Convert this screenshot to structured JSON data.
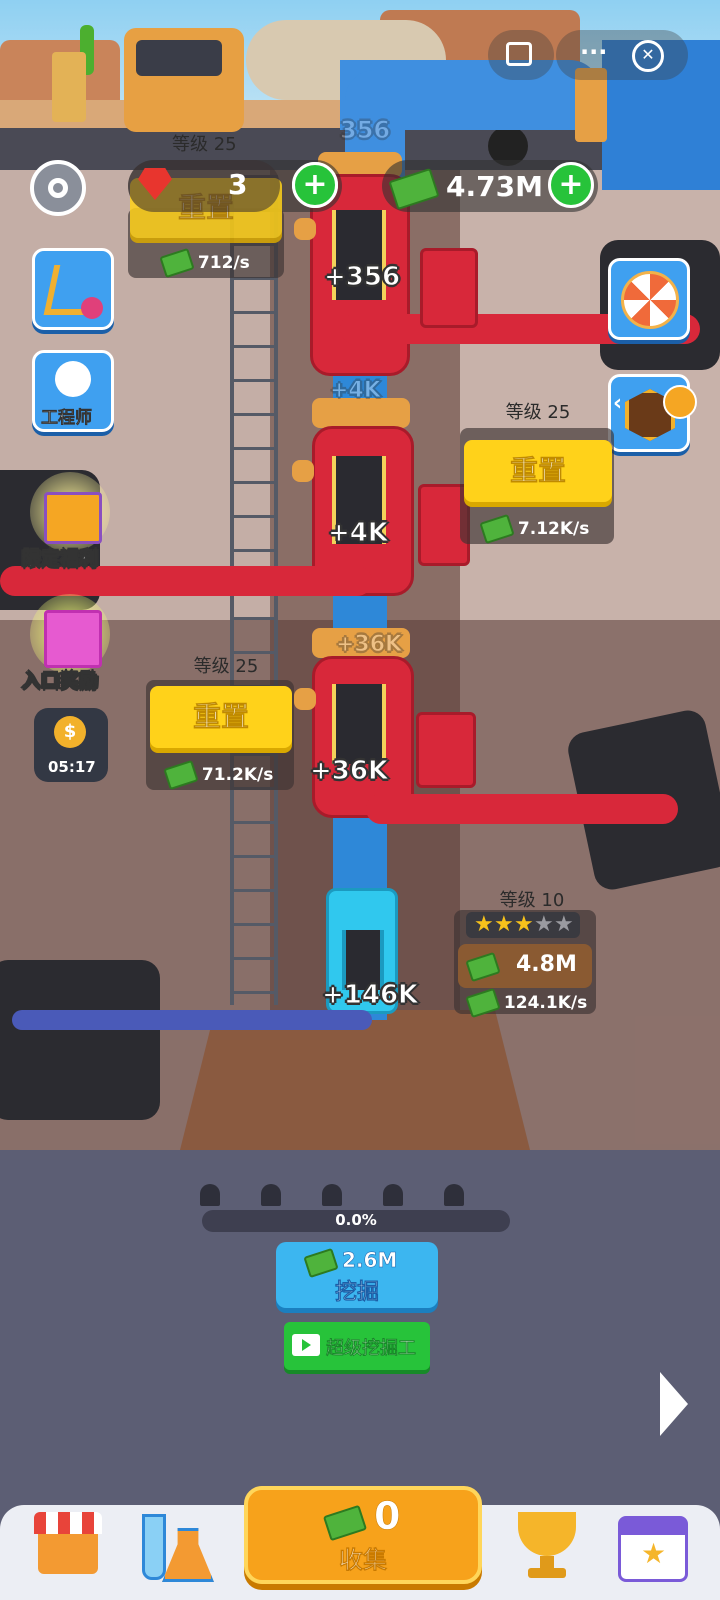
{
  "top_bar": {
    "gems": "3",
    "cash": "4.73M",
    "truck_level": "等级 25",
    "truck_faded": "356"
  },
  "truck_panel": {
    "button_label": "重置",
    "rate": "712/s"
  },
  "side_left": {
    "engineer_label": "工程师",
    "limited_label": "限定福利",
    "entry_label": "入口奖励",
    "timer": "05:17"
  },
  "wells": [
    {
      "production": "+356"
    },
    {
      "production": "+4K",
      "faded": "+4K",
      "level": "等级 25",
      "button_label": "重置",
      "rate": "7.12K/s"
    },
    {
      "production": "+36K",
      "faded": "+36K",
      "level": "等级 25",
      "button_label": "重置",
      "rate": "71.2K/s"
    },
    {
      "production": "+146K",
      "level": "等级 10",
      "stars": 3,
      "stars_max": 5,
      "upgrade_cost": "4.8M",
      "rate": "124.1K/s"
    }
  ],
  "dig": {
    "progress": "0.0%",
    "progress_value": 0.0,
    "workers": 5,
    "cost": "2.6M",
    "label": "挖掘",
    "super_label": "超级挖掘工"
  },
  "collect": {
    "amount": "0",
    "label": "收集"
  },
  "colors": {
    "red": "#d8283a",
    "yellow": "#ffd21a",
    "green": "#27c33a",
    "blue": "#3fa0f0",
    "orange": "#f7a21b"
  }
}
